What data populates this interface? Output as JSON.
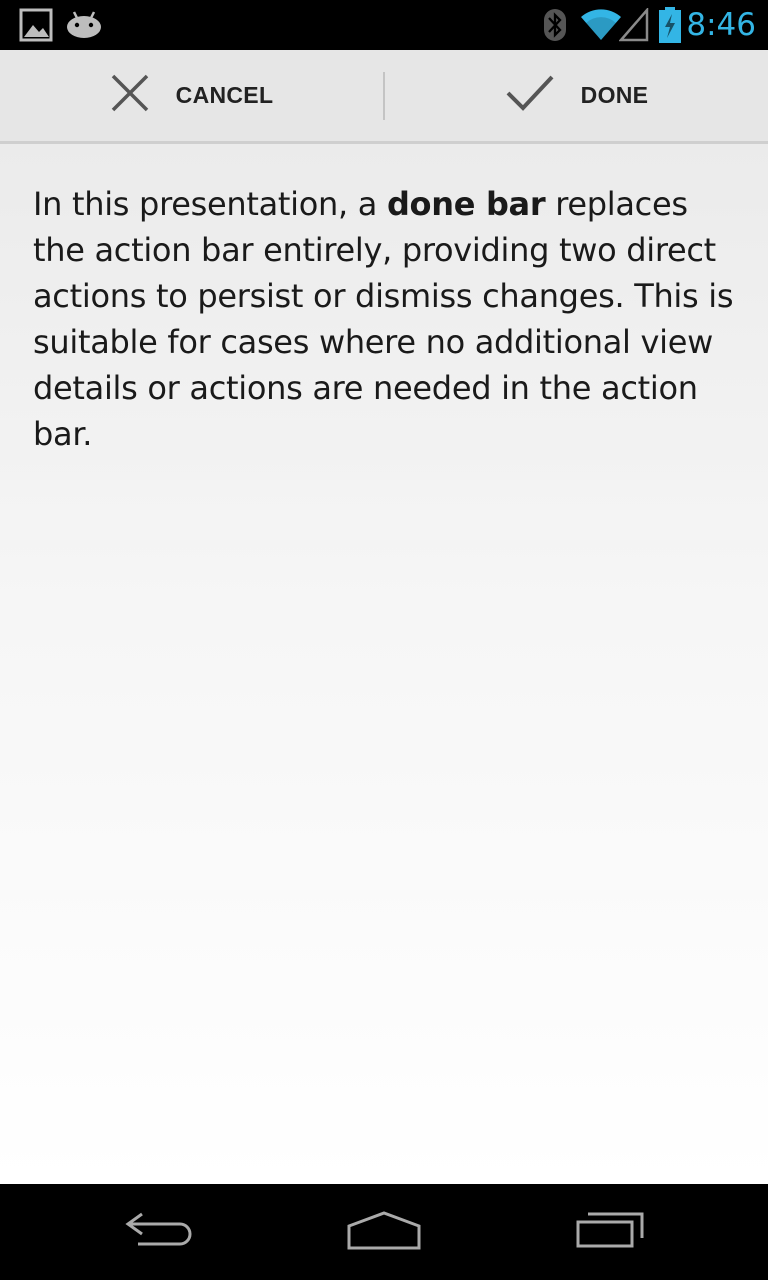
{
  "status_bar": {
    "time": "8:46",
    "icons": [
      "gallery-notification-icon",
      "android-notification-icon",
      "bluetooth-icon",
      "wifi-icon",
      "signal-icon",
      "battery-charging-icon"
    ]
  },
  "done_bar": {
    "cancel_label": "CANCEL",
    "done_label": "DONE",
    "cancel_icon": "close-icon",
    "done_icon": "checkmark-icon"
  },
  "content": {
    "text_before": "In this presentation, a ",
    "text_bold": "done bar",
    "text_after": " replaces the action bar entirely, providing two direct actions to persist or dismiss changes. This is suitable for cases where no additional view details or actions are needed in the action bar."
  },
  "nav_bar": {
    "icons": [
      "back-icon",
      "home-icon",
      "recent-apps-icon"
    ]
  },
  "colors": {
    "accent": "#33b5e5",
    "bar_background": "#e6e6e6"
  }
}
